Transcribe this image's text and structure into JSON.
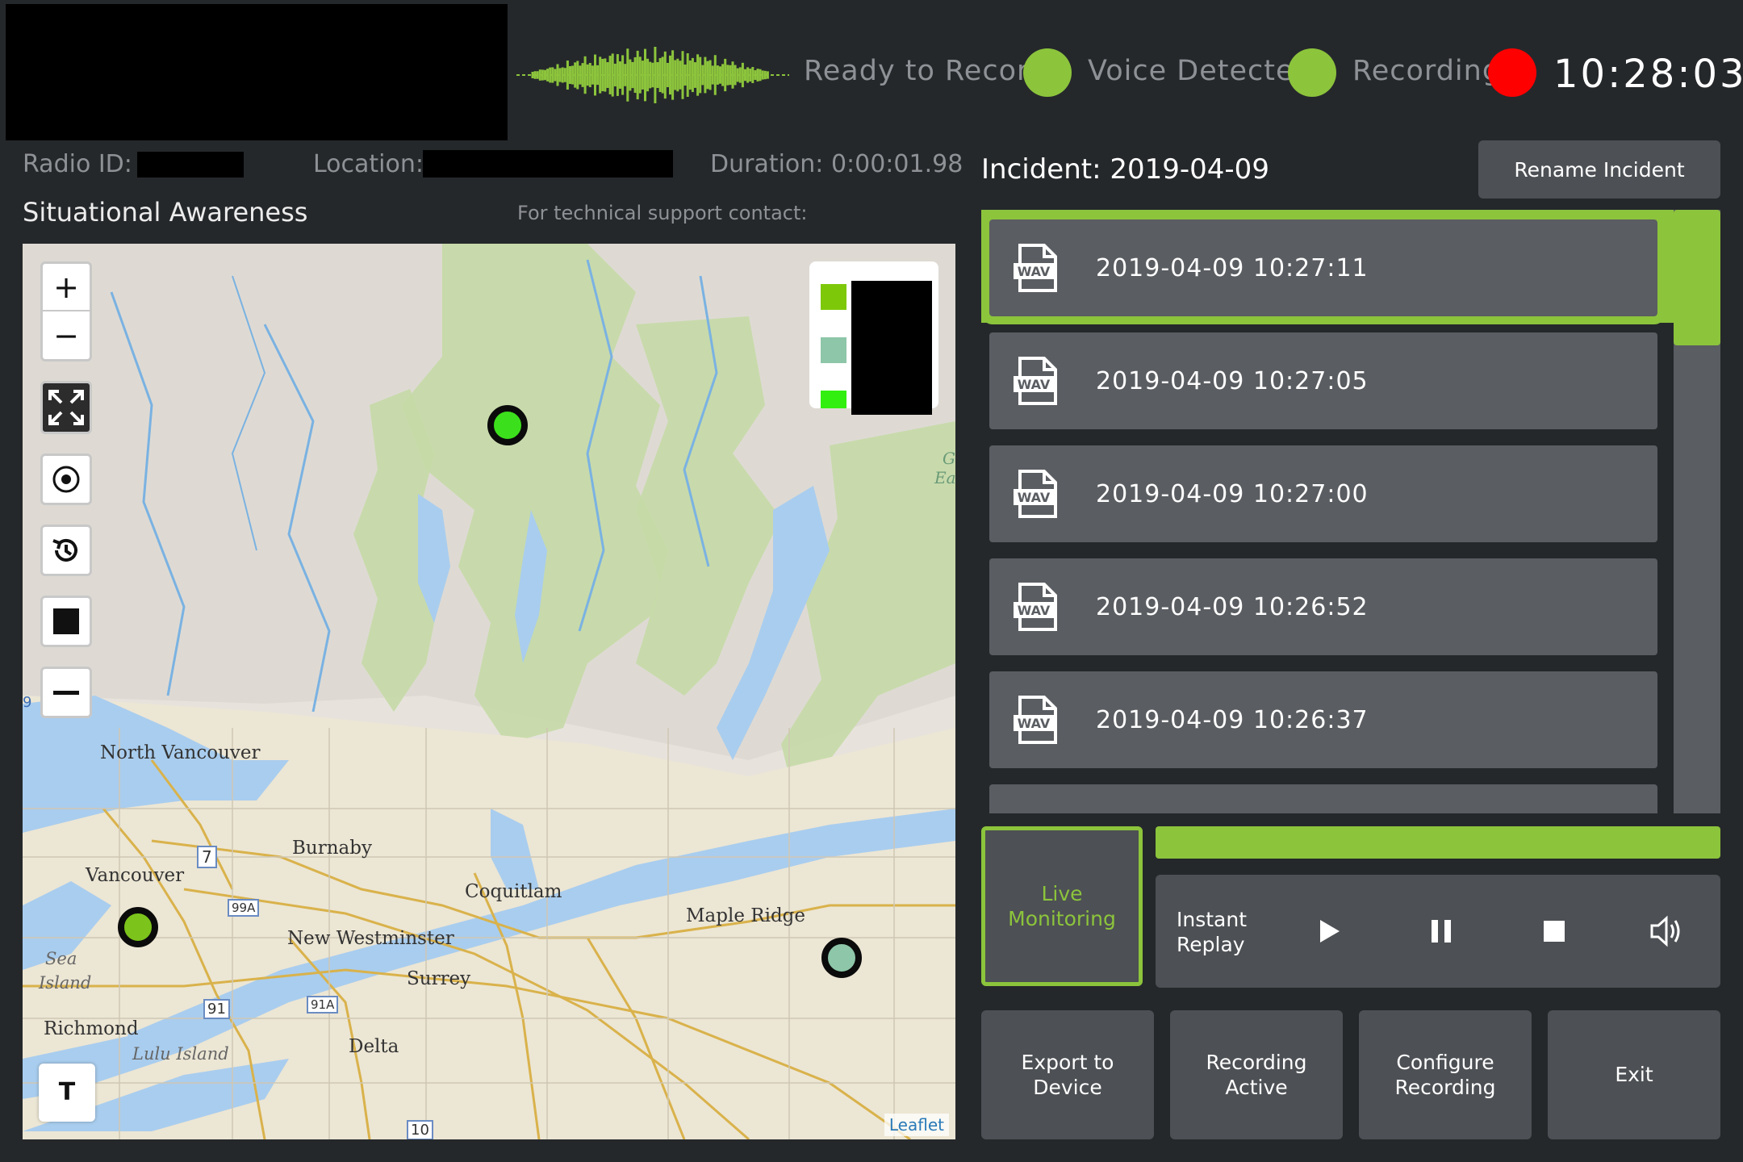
{
  "header": {
    "status": {
      "ready_label": "Ready to Record",
      "voice_label": "Voice Detected",
      "recording_label": "Recording"
    },
    "colors": {
      "ready": "#8cc43c",
      "voice": "#8cc43c",
      "recording": "#ff0000"
    },
    "clock": "10:28:03"
  },
  "info": {
    "radio_id_label": "Radio ID:",
    "location_label": "Location:",
    "duration_label": "Duration: 0:00:01.98"
  },
  "map_section": {
    "title": "Situational Awareness",
    "support": "For technical support contact:",
    "attribution": "Leaflet",
    "labels": {
      "north_vancouver": "North Vancouver",
      "vancouver": "Vancouver",
      "burnaby": "Burnaby",
      "coquitlam": "Coquitlam",
      "new_westminster": "New Westminster",
      "maple_ridge": "Maple Ridge",
      "surrey": "Surrey",
      "richmond": "Richmond",
      "delta": "Delta",
      "sea_island_1": "Sea",
      "sea_island_2": "Island",
      "lulu_island": "Lulu Island",
      "hwy_7": "7",
      "hwy_99a": "99A",
      "hwy_91": "91",
      "hwy_91a": "91A",
      "hwy_10": "10",
      "edge_9": "9",
      "edge_g": "G",
      "edge_ea": "Ea"
    },
    "controls": {
      "zoom_in": "+",
      "zoom_out": "−",
      "text_tool": "T"
    },
    "legend_colors": [
      "#7ec80a",
      "#8dc6a8",
      "#32ef0f"
    ],
    "markers": [
      {
        "name": "green-marker-north",
        "color": "#3cdf1c"
      },
      {
        "name": "green-marker-vancouver",
        "color": "#7cc31b"
      },
      {
        "name": "teal-marker-maple-ridge",
        "color": "#8dc6a8"
      }
    ]
  },
  "incident": {
    "title": "Incident: 2019-04-09",
    "rename_label": "Rename Incident",
    "files": [
      {
        "label": "2019-04-09 10:27:11",
        "selected": true
      },
      {
        "label": "2019-04-09 10:27:05",
        "selected": false
      },
      {
        "label": "2019-04-09 10:27:00",
        "selected": false
      },
      {
        "label": "2019-04-09 10:26:52",
        "selected": false
      },
      {
        "label": "2019-04-09 10:26:37",
        "selected": false
      }
    ],
    "file_icon_text": "WAV"
  },
  "playback": {
    "live_label": "Live Monitoring",
    "instant_replay_label": "Instant Replay",
    "progress": 1.0
  },
  "actions": {
    "export": "Export to Device",
    "recording_active": "Recording Active",
    "configure": "Configure Recording",
    "exit": "Exit"
  }
}
